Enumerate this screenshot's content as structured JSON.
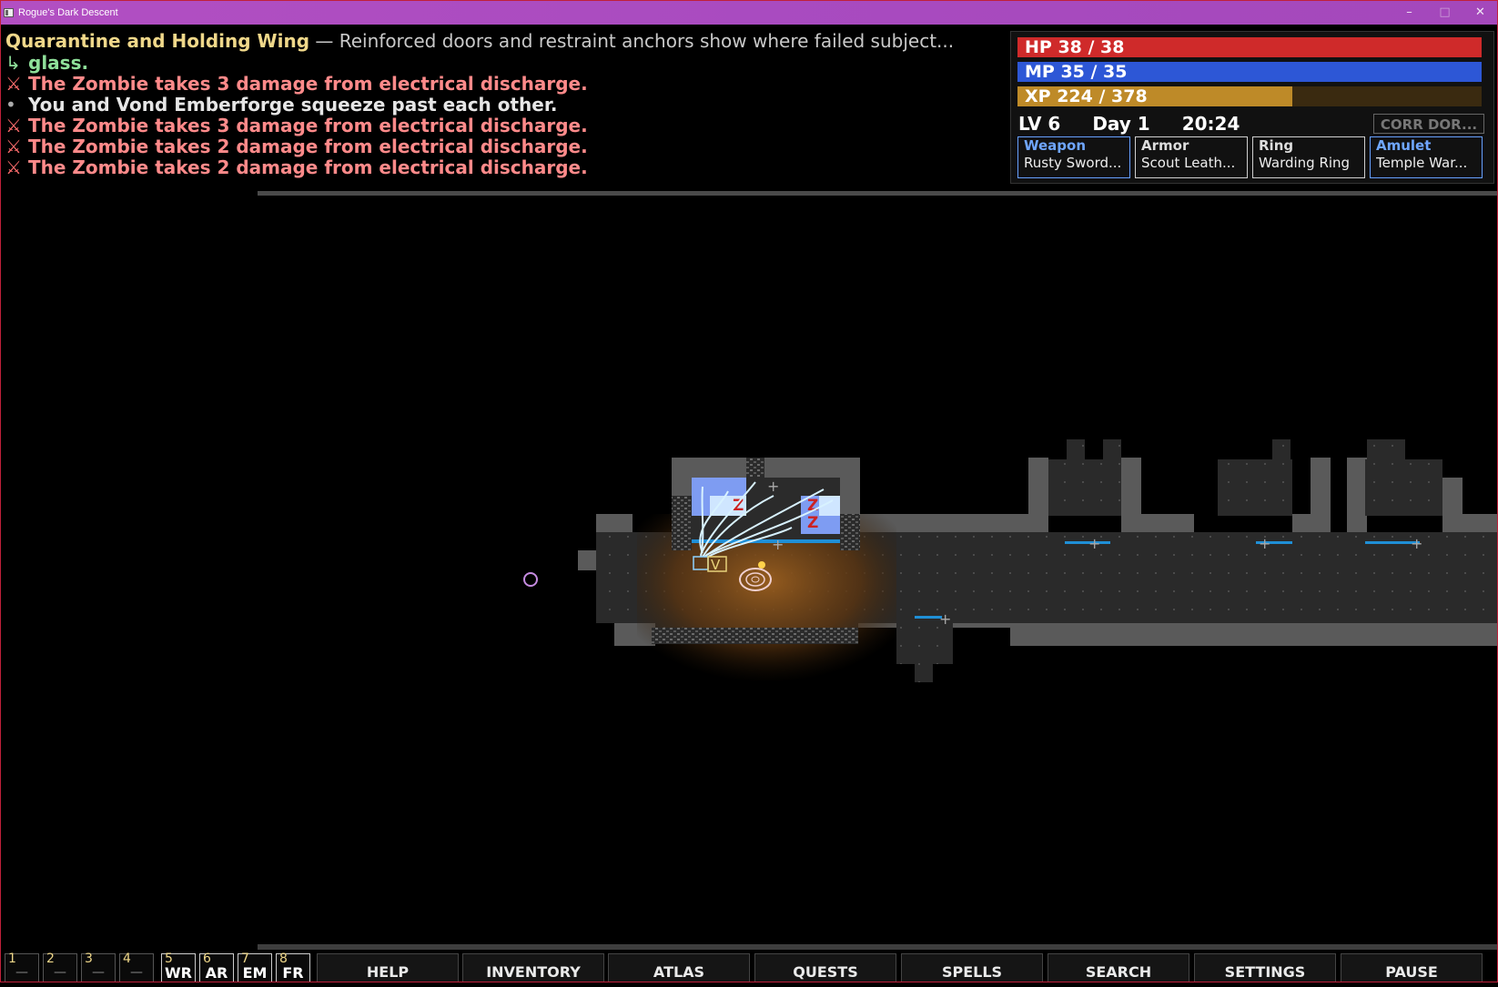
{
  "window": {
    "title": "Rogue's Dark Descent",
    "controls": [
      "–",
      "□",
      "✕"
    ]
  },
  "log": {
    "location_name": "Quarantine and Holding Wing",
    "location_desc": "— Reinforced doors and restraint anchors show where failed subject...",
    "messages": [
      {
        "marker": "↳",
        "text": "glass.",
        "kind": "cont"
      },
      {
        "marker": "⚔",
        "text": "The Zombie takes 3 damage from electrical discharge.",
        "kind": "dmg"
      },
      {
        "marker": "•",
        "text": "You and Vond Emberforge squeeze past each other.",
        "kind": "info"
      },
      {
        "marker": "⚔",
        "text": "The Zombie takes 3 damage from electrical discharge.",
        "kind": "dmg"
      },
      {
        "marker": "⚔",
        "text": "The Zombie takes 2 damage from electrical discharge.",
        "kind": "dmg"
      },
      {
        "marker": "⚔",
        "text": "The Zombie takes 2 damage from electrical discharge.",
        "kind": "dmg"
      }
    ]
  },
  "status": {
    "hp_label": "HP  38 / 38",
    "hp_fraction": 1.0,
    "mp_label": "MP  35 / 35",
    "mp_fraction": 1.0,
    "xp_label": "XP  224 / 378",
    "xp_fraction": 0.593,
    "level": "LV 6",
    "day": "Day 1",
    "time": "20:24",
    "corr_button": "CORR DOR...",
    "equipment": [
      {
        "slot": "Weapon",
        "item": "Rusty Sword...",
        "highlight": true
      },
      {
        "slot": "Armor",
        "item": "Scout Leath...",
        "highlight": false
      },
      {
        "slot": "Ring",
        "item": "Warding Ring",
        "highlight": false
      },
      {
        "slot": "Amulet",
        "item": "Temple War...",
        "highlight": true
      }
    ]
  },
  "map": {
    "zombie_glyph": "Z",
    "companion_glyph": "V",
    "door_glyph": "+"
  },
  "hotbar": {
    "slots": [
      {
        "num": "1",
        "label": "—"
      },
      {
        "num": "2",
        "label": "—"
      },
      {
        "num": "3",
        "label": "—"
      },
      {
        "num": "4",
        "label": "—"
      },
      {
        "num": "5",
        "label": "WR"
      },
      {
        "num": "6",
        "label": "AR"
      },
      {
        "num": "7",
        "label": "EM"
      },
      {
        "num": "8",
        "label": "FR"
      }
    ],
    "buttons": [
      "HELP",
      "INVENTORY",
      "ATLAS",
      "QUESTS",
      "SPELLS",
      "SEARCH",
      "SETTINGS",
      "PAUSE"
    ]
  },
  "colors": {
    "titlebar": "#a94bc0",
    "hp": "#cf2a2a",
    "mp": "#2d57d6",
    "xp": "#be8a28",
    "location_name": "#f0d88a",
    "damage_text": "#ff8a8a",
    "highlight_slot": "#6fa6ff"
  }
}
